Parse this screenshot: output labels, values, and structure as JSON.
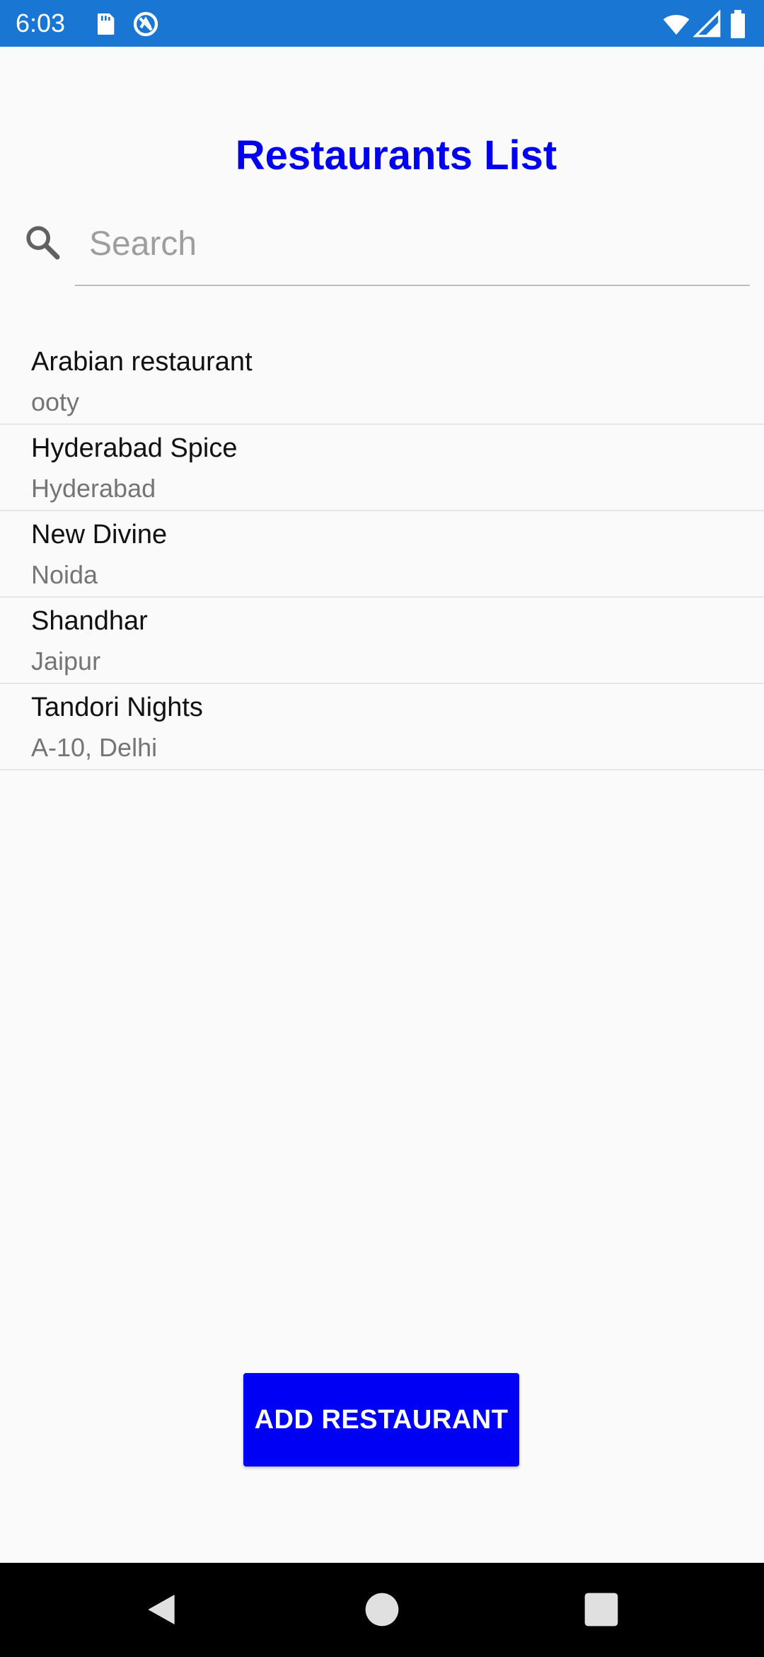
{
  "status_bar": {
    "time": "6:03",
    "icons": [
      "sd-card-icon",
      "sync-icon",
      "wifi-icon",
      "signal-icon",
      "battery-icon"
    ],
    "background_color": "#1976d2"
  },
  "header": {
    "title": "Restaurants List",
    "title_color": "#0000ee"
  },
  "search": {
    "placeholder": "Search",
    "value": "",
    "icon": "search-icon"
  },
  "restaurants": [
    {
      "name": "Arabian restaurant",
      "location": "ooty"
    },
    {
      "name": "Hyderabad Spice",
      "location": "Hyderabad"
    },
    {
      "name": "New Divine",
      "location": "Noida"
    },
    {
      "name": "Shandhar",
      "location": "Jaipur"
    },
    {
      "name": "Tandori Nights",
      "location": "A-10, Delhi"
    }
  ],
  "actions": {
    "add_label": "ADD RESTAURANT",
    "add_color": "#0000f5"
  },
  "nav_bar": {
    "buttons": [
      "back-icon",
      "home-icon",
      "recents-icon"
    ]
  }
}
